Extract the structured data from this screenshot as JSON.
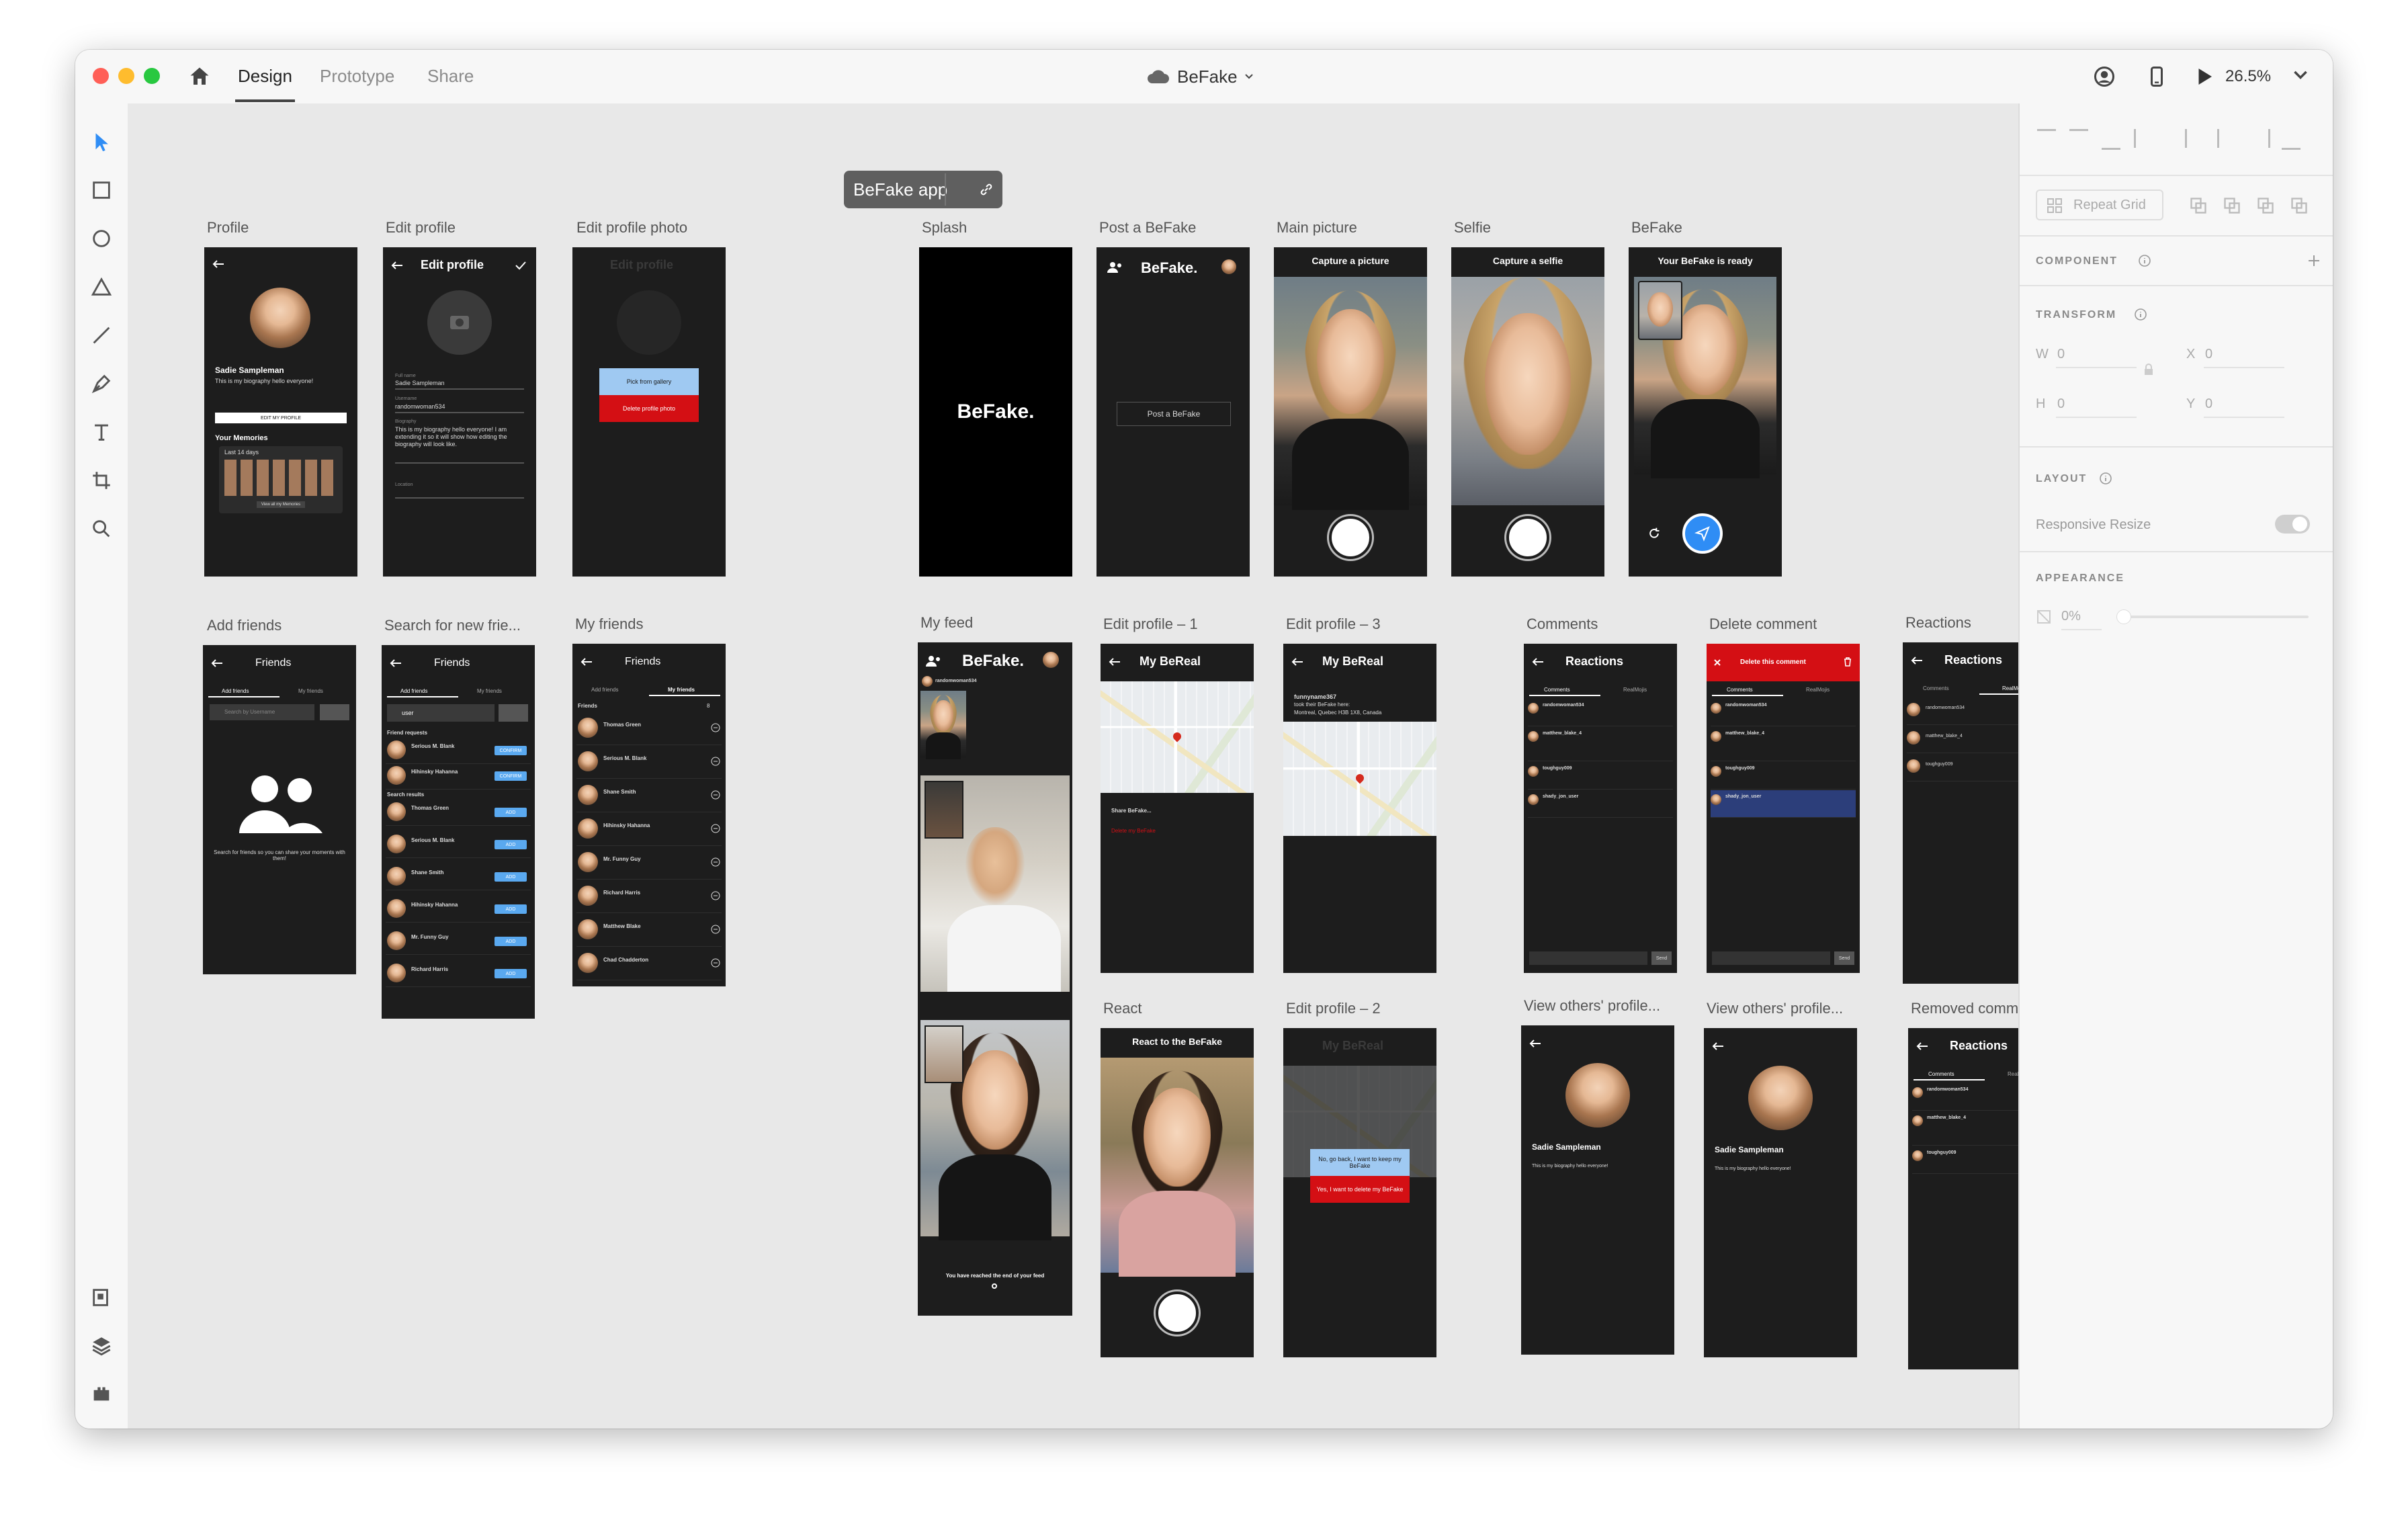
{
  "app": {
    "nav_tabs": [
      "Design",
      "Prototype",
      "Share"
    ],
    "document_title": "BeFake",
    "zoom": "26.5%"
  },
  "canvas": {
    "group_label": "BeFake app",
    "artboards": {
      "profile": "Profile",
      "edit_profile": "Edit profile",
      "edit_profile_photo": "Edit profile photo",
      "splash": "Splash",
      "post_befake": "Post a BeFake",
      "main_picture": "Main picture",
      "selfie": "Selfie",
      "befake": "BeFake",
      "add_friends": "Add friends",
      "search_friends": "Search for new frie...",
      "my_friends": "My friends",
      "my_feed": "My feed",
      "edit_profile_1": "Edit profile – 1",
      "edit_profile_3": "Edit profile – 3",
      "comments": "Comments",
      "delete_comment": "Delete comment",
      "reactions": "Reactions",
      "react": "React",
      "edit_profile_2": "Edit profile – 2",
      "view_others_1": "View others' profile...",
      "view_others_2": "View others' profile...",
      "removed_comment": "Removed comment"
    },
    "screens": {
      "profile_name": "Sadie Sampleman",
      "profile_bio": "This is my biography hello everyone!",
      "edit_profile_btn": "EDIT MY PROFILE",
      "your_memories": "Your Memories",
      "last_days": "Last 14 days",
      "view_memories": "View all my Memories",
      "edit_profile_title": "Edit profile",
      "full_name_label": "Full name",
      "full_name_value": "Sadie Sampleman",
      "username_label": "Username",
      "username_value": "randomwoman534",
      "biography_label": "Biography",
      "biography_value": "This is my biography hello everyone! I am extending it so it will show how editing the biography will look like.",
      "location_label": "Location",
      "pick_gallery": "Pick from gallery",
      "delete_photo": "Delete profile photo",
      "brand": "BeFake.",
      "post_a_befake": "Post a BeFake",
      "capture_picture": "Capture a picture",
      "capture_selfie": "Capture a selfie",
      "befake_ready": "Your BeFake is ready",
      "friends_title": "Friends",
      "tab_add_friends": "Add friends",
      "tab_my_friends": "My friends",
      "search_placeholder": "Search by Username",
      "search_empty_text": "Search for friends so you can share your moments with them!",
      "search_typed": "user",
      "friend_requests": "Friend requests",
      "search_results": "Search results",
      "confirm": "CONFIRM",
      "add": "ADD",
      "friends_section": "Friends",
      "friends_count": "8",
      "request_names": [
        "Serious M. Blank",
        "Hihinsky Hahanna"
      ],
      "result_names": [
        "Thomas Green",
        "Serious M. Blank",
        "Shane Smith",
        "Hihinsky Hahanna",
        "Mr. Funny Guy",
        "Richard Harris"
      ],
      "friend_names": [
        "Thomas Green",
        "Serious M. Blank",
        "Shane Smith",
        "Hihinsky Hahanna",
        "Mr. Funny Guy",
        "Richard Harris",
        "Matthew Blake",
        "Chad Chadderton"
      ],
      "feed_end": "You have reached the end of your feed",
      "my_bereal": "My BeReal",
      "share_befake": "Share BeFake...",
      "delete_befake": "Delete my BeFake",
      "funny_user": "funnyname367",
      "location_text": "took their BeFake here:",
      "location_city": "Montreal, Quebec H3B 1X8, Canada",
      "no_keep": "No, go back, I want to keep my BeFake",
      "yes_delete": "Yes, I want to delete my BeFake",
      "react_title": "React to the BeFake",
      "reactions_title": "Reactions",
      "tab_comments": "Comments",
      "tab_realmojis": "RealMojis",
      "delete_comment_title": "Delete this comment",
      "commenters": [
        "randomwoman534",
        "matthew_blake_4",
        "toughguy009",
        "shady_jon_user"
      ],
      "send": "Send"
    }
  },
  "panel": {
    "repeat_grid": "Repeat Grid",
    "component": "COMPONENT",
    "transform": "TRANSFORM",
    "w_label": "W",
    "w_value": "0",
    "h_label": "H",
    "h_value": "0",
    "x_label": "X",
    "x_value": "0",
    "y_label": "Y",
    "y_value": "0",
    "layout": "LAYOUT",
    "responsive_resize": "Responsive Resize",
    "appearance": "APPEARANCE",
    "opacity": "0%"
  },
  "colors": {
    "accent_blue": "#2f8df5",
    "delete_red": "#d40f14",
    "artboard_bg": "#1d1d1d",
    "canvas_bg": "#e8e8e8"
  }
}
